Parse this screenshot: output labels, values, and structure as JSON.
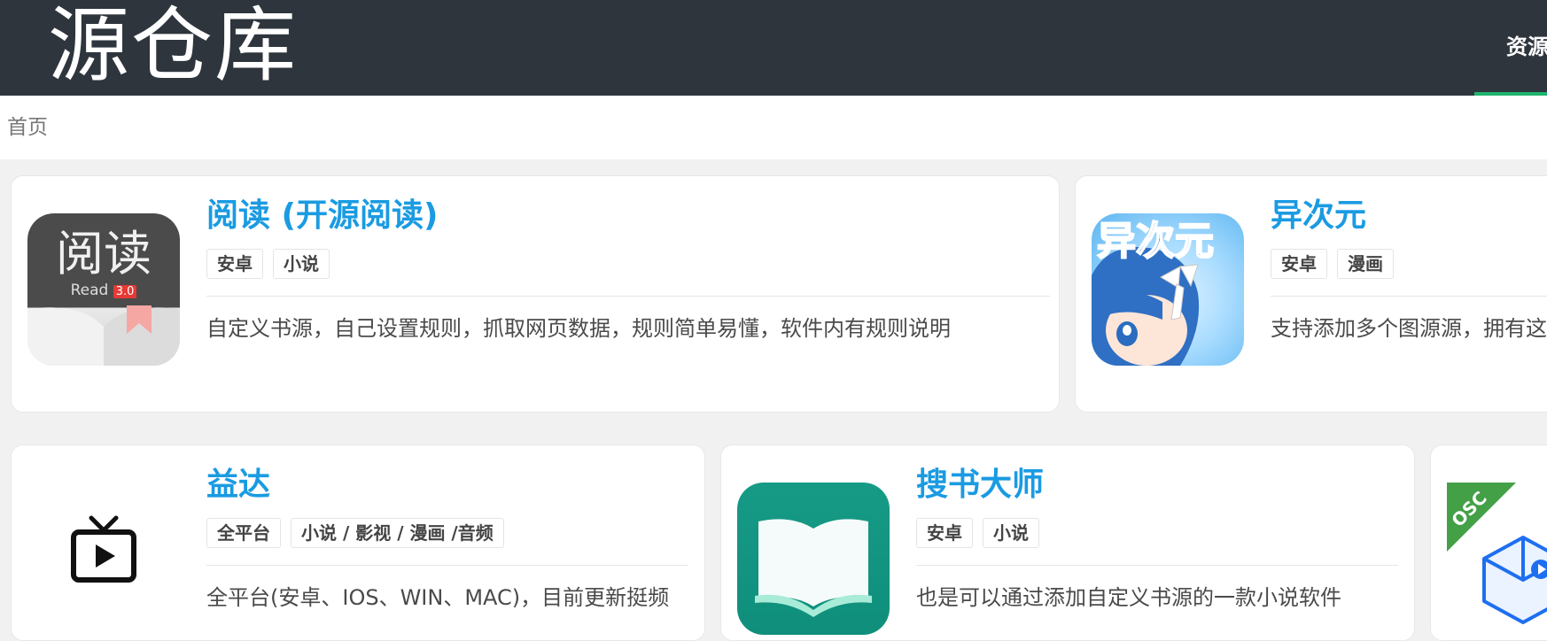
{
  "header": {
    "logo": "源仓库",
    "nav_item": "资源",
    "accent_color": "#1fb46f",
    "background_color": "#2e353d"
  },
  "breadcrumb": {
    "home": "首页"
  },
  "cards": [
    {
      "title": "阅读 (开源阅读)",
      "tags": [
        "安卓",
        "小说"
      ],
      "description": "自定义书源，自己设置规则，抓取网页数据，规则简单易懂，软件内有规则说明",
      "icon": {
        "name": "yuedu-app-icon",
        "text_main": "阅读",
        "text_sub": "Read",
        "version": "3.0"
      }
    },
    {
      "title": "异次元",
      "tags": [
        "安卓",
        "漫画"
      ],
      "description": "支持添加多个图源源，拥有这",
      "icon": {
        "name": "yiciyuan-app-icon",
        "text_main": "异次元"
      }
    },
    {
      "title": "益达",
      "tags": [
        "全平台",
        "小说 / 影视 / 漫画 /音频"
      ],
      "description": "全平台(安卓、IOS、WIN、MAC)，目前更新挺频",
      "icon": {
        "name": "tv-play-icon"
      }
    },
    {
      "title": "搜书大师",
      "tags": [
        "安卓",
        "小说"
      ],
      "description": "也是可以通过添加自定义书源的一款小说软件",
      "icon": {
        "name": "open-book-app-icon"
      }
    },
    {
      "title": "",
      "tags": [],
      "description": "",
      "icon": {
        "name": "osc-cube-icon",
        "ribbon": "OSC"
      }
    }
  ],
  "colors": {
    "title_blue": "#1a9be2",
    "page_background": "#f1f1f1"
  }
}
